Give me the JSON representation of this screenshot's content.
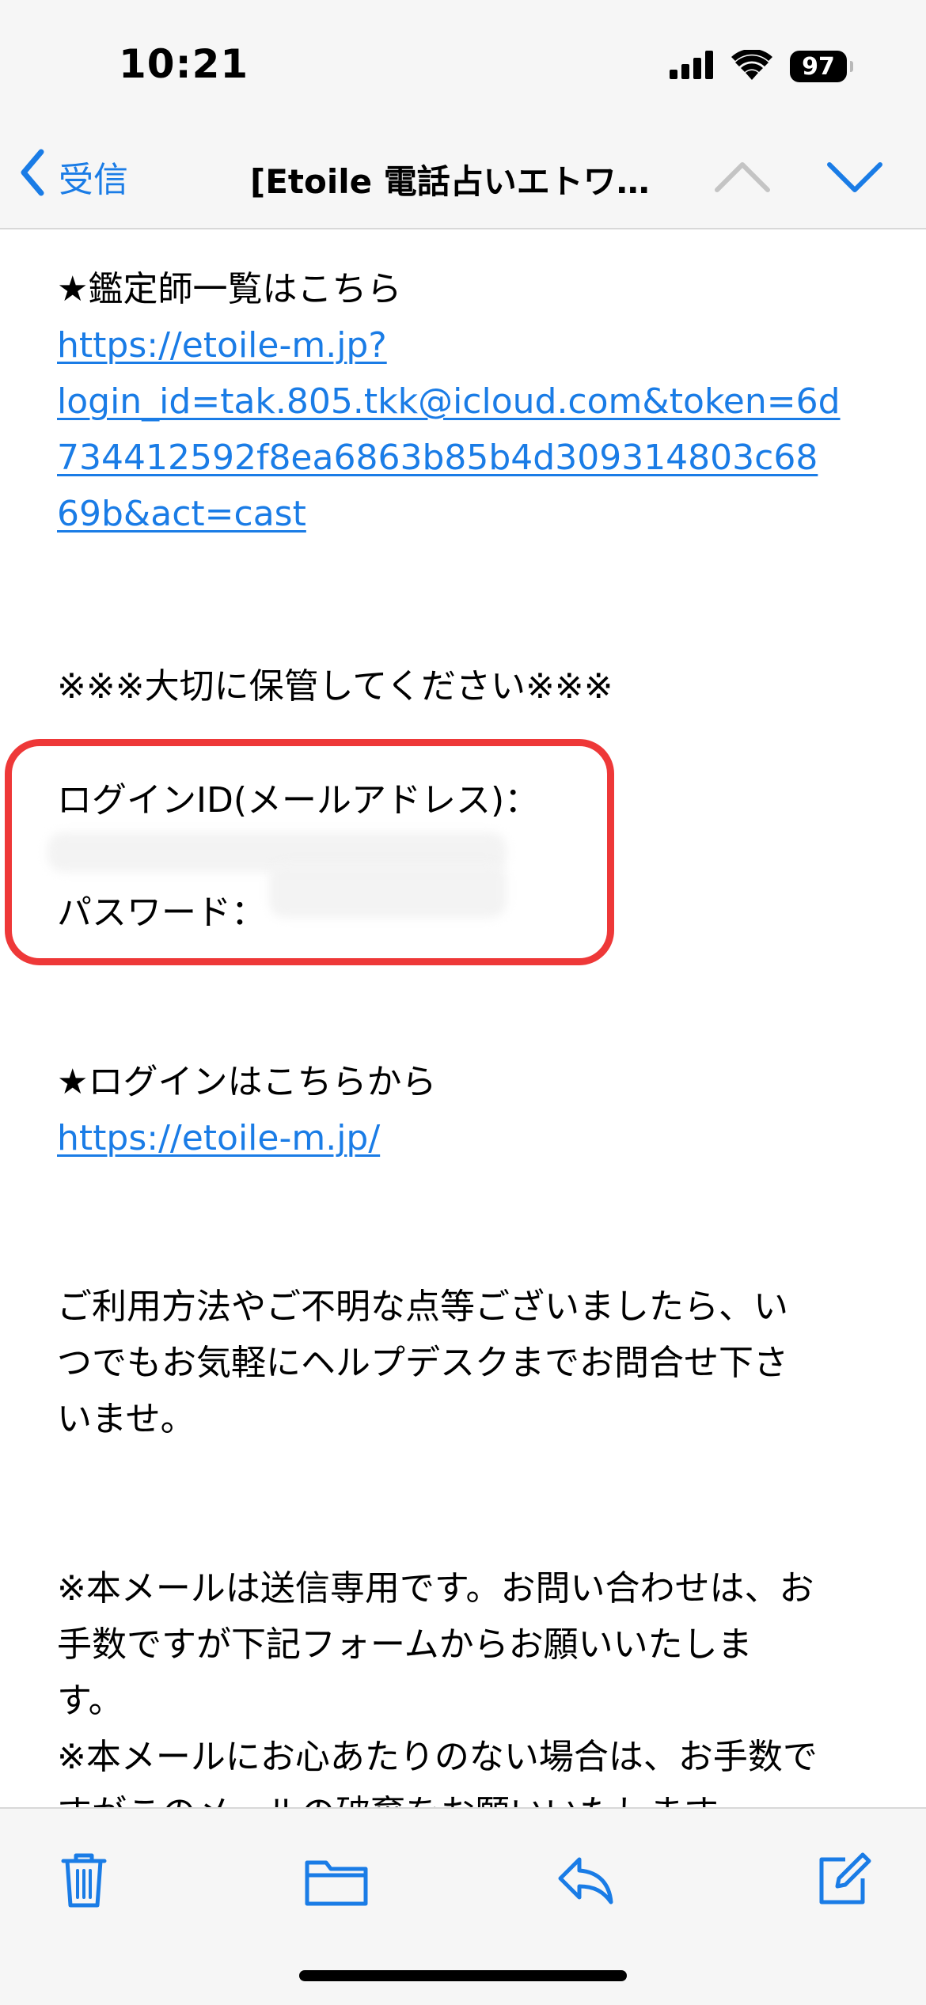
{
  "status_bar": {
    "time": "10:21",
    "battery": "97",
    "icons": [
      "signal-icon",
      "wifi-icon",
      "battery-icon"
    ]
  },
  "nav": {
    "back_label": "受信",
    "title": "[Etoile 電話占いエトワ…",
    "icons": [
      "chevron-left-icon",
      "chevron-up-icon",
      "chevron-down-icon"
    ]
  },
  "email": {
    "counselor_heading": "★鑑定師一覧はこちら",
    "counselor_link_lines": [
      "https://etoile-m.jp?",
      "login_id=tak.805.tkk@icloud.com&token=6d",
      "734412592f8ea6863b85b4d309314803c68",
      "69b&act=cast"
    ],
    "keep_notice": "※※※大切に保管してください※※※",
    "login_id_label": "ログインID(メールアドレス)：",
    "password_label": "パスワード：",
    "login_heading": "★ログインはこちらから",
    "login_link": "https://etoile-m.jp/",
    "help_lines": [
      "ご利用方法やご不明な点等ございましたら、い",
      "つでもお気軽にヘルプデスクまでお問合せ下さ",
      "いませ。"
    ],
    "notice_lines": [
      "※本メールは送信専用です。お問い合わせは、お",
      "手数ですが下記フォームからお願いいたしま",
      "す。",
      "※本メールにお心あたりのない場合は、お手数で",
      "すがこのメールの破棄をお願いいたします。"
    ]
  },
  "toolbar": {
    "icons": [
      "trash-icon",
      "folder-icon",
      "reply-icon",
      "compose-icon"
    ]
  },
  "colors": {
    "link": "#1a7ce6",
    "highlight": "#ee3838",
    "bar_bg": "#f6f6f6"
  }
}
